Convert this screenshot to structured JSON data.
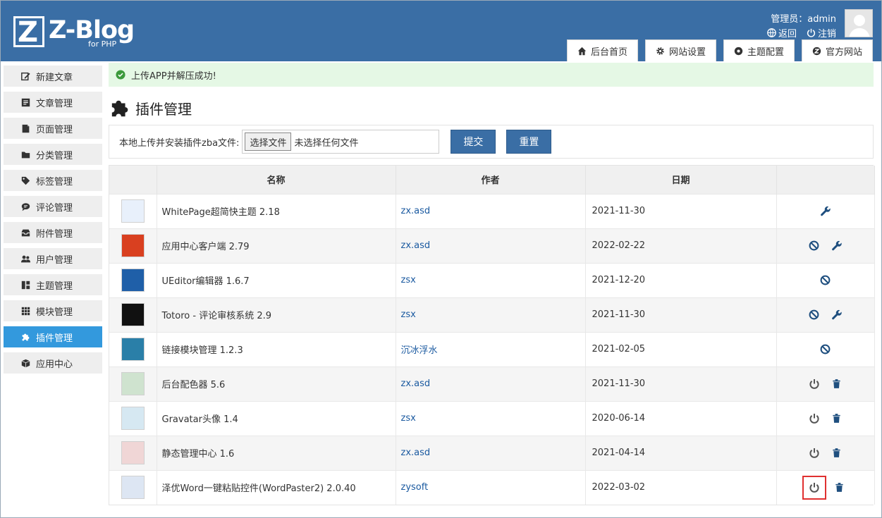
{
  "header": {
    "logo_text": "Z-Blog",
    "logo_sub": "for PHP",
    "admin_label": "管理员：admin",
    "back_label": "返回",
    "logout_label": "注销",
    "tabs": [
      {
        "label": "后台首页",
        "icon": "home-icon"
      },
      {
        "label": "网站设置",
        "icon": "gear-icon"
      },
      {
        "label": "主题配置",
        "icon": "palette-icon"
      },
      {
        "label": "官方网站",
        "icon": "zblog-icon"
      }
    ]
  },
  "sidebar": {
    "items": [
      {
        "label": "新建文章",
        "icon": "edit-icon"
      },
      {
        "label": "文章管理",
        "icon": "article-icon"
      },
      {
        "label": "页面管理",
        "icon": "page-icon"
      },
      {
        "label": "分类管理",
        "icon": "folder-icon"
      },
      {
        "label": "标签管理",
        "icon": "tag-icon"
      },
      {
        "label": "评论管理",
        "icon": "comment-icon"
      },
      {
        "label": "附件管理",
        "icon": "attachment-icon"
      },
      {
        "label": "用户管理",
        "icon": "users-icon"
      },
      {
        "label": "主题管理",
        "icon": "theme-icon"
      },
      {
        "label": "模块管理",
        "icon": "grid-icon"
      },
      {
        "label": "插件管理",
        "icon": "puzzle-icon"
      },
      {
        "label": "应用中心",
        "icon": "box-icon"
      }
    ]
  },
  "alert": {
    "text": "上传APP并解压成功!"
  },
  "page": {
    "title": "插件管理"
  },
  "upload": {
    "label": "本地上传并安装插件zba文件:",
    "choose_button": "选择文件",
    "no_file_text": "未选择任何文件",
    "submit_button": "提交",
    "reset_button": "重置"
  },
  "table": {
    "headers": [
      "",
      "名称",
      "作者",
      "日期",
      ""
    ],
    "rows": [
      {
        "name": "WhitePage超简快主题 2.18",
        "author": "zx.asd",
        "date": "2021-11-30",
        "actions": [
          "wrench"
        ],
        "icon_color": "#e8f0fb"
      },
      {
        "name": "应用中心客户端 2.79",
        "author": "zx.asd",
        "date": "2022-02-22",
        "actions": [
          "disable",
          "wrench"
        ],
        "icon_color": "#d94020"
      },
      {
        "name": "UEditor编辑器 1.6.7",
        "author": "zsx",
        "date": "2021-12-20",
        "actions": [
          "disable"
        ],
        "icon_color": "#1f5fa8"
      },
      {
        "name": "Totoro - 评论审核系统 2.9",
        "author": "zsx",
        "date": "2021-11-30",
        "actions": [
          "disable",
          "wrench"
        ],
        "icon_color": "#111111"
      },
      {
        "name": "链接模块管理 1.2.3",
        "author": "沉冰浮水",
        "date": "2021-02-05",
        "actions": [
          "disable"
        ],
        "icon_color": "#2a7fa8"
      },
      {
        "name": "后台配色器 5.6",
        "author": "zx.asd",
        "date": "2021-11-30",
        "actions": [
          "power",
          "trash"
        ],
        "icon_color": "#cfe3cf"
      },
      {
        "name": "Gravatar头像 1.4",
        "author": "zsx",
        "date": "2020-06-14",
        "actions": [
          "power",
          "trash"
        ],
        "icon_color": "#d6e8f2"
      },
      {
        "name": "静态管理中心 1.6",
        "author": "zx.asd",
        "date": "2021-04-14",
        "actions": [
          "power",
          "trash"
        ],
        "icon_color": "#f0d6d6"
      },
      {
        "name": "泽优Word一键粘贴控件(WordPaster2) 2.0.40",
        "author": "zysoft",
        "date": "2022-03-02",
        "actions": [
          "power",
          "trash"
        ],
        "icon_color": "#dde6f3",
        "highlight_power": true
      }
    ]
  },
  "colors": {
    "header_bg": "#3a6ea5",
    "active_sidebar": "#3399dd",
    "link": "#1b5aa0",
    "action_icon": "#1f4f7f",
    "alert_bg": "#e5f8e5"
  }
}
